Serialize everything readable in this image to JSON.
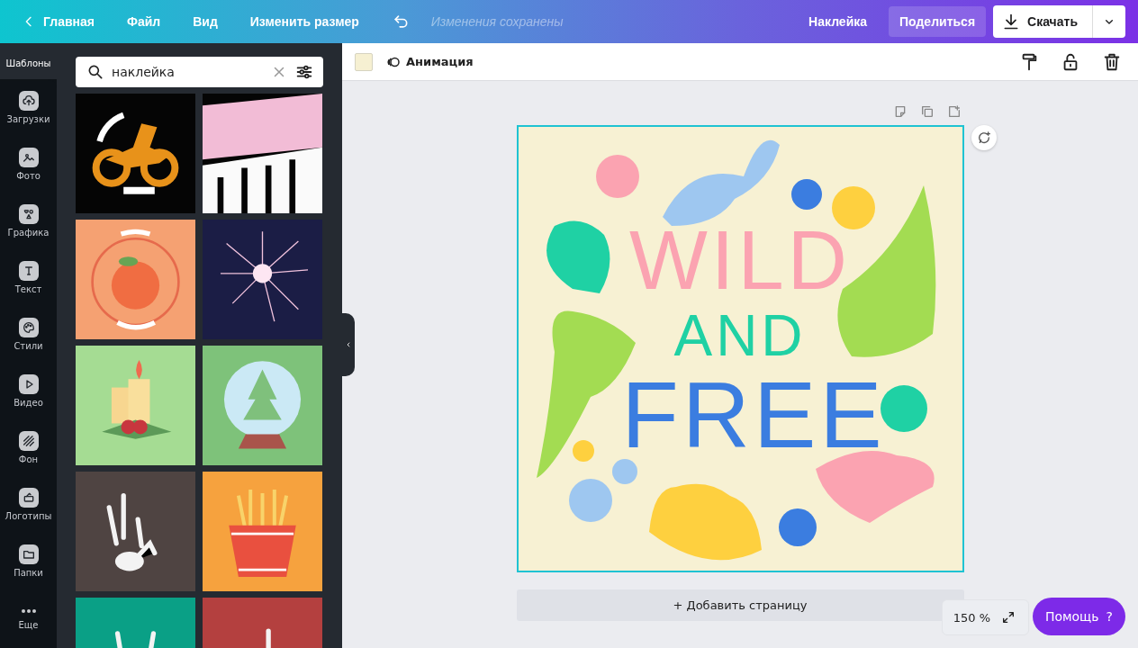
{
  "topbar": {
    "back": "Главная",
    "menu": [
      {
        "label": "Файл"
      },
      {
        "label": "Вид"
      },
      {
        "label": "Изменить размер"
      }
    ],
    "save_status": "Изменения сохранены",
    "design_name": "Наклейка",
    "share": "Поделиться",
    "download": "Скачать"
  },
  "sidebar": {
    "items": [
      {
        "label": "Шаблоны",
        "selected": true
      },
      {
        "label": "Загрузки",
        "selected": false
      },
      {
        "label": "Фото",
        "selected": false
      },
      {
        "label": "Графика",
        "selected": false
      },
      {
        "label": "Текст",
        "selected": false
      },
      {
        "label": "Стили",
        "selected": false
      },
      {
        "label": "Видео",
        "selected": false
      },
      {
        "label": "Фон",
        "selected": false
      },
      {
        "label": "Логотипы",
        "selected": false
      },
      {
        "label": "Папки",
        "selected": false
      },
      {
        "label": "Еще",
        "selected": false
      }
    ]
  },
  "panel": {
    "search": {
      "value": "наклейка"
    }
  },
  "toolbar": {
    "animation": "Анимация"
  },
  "design": {
    "words": [
      {
        "text": "WILD",
        "color": "#fba3b1"
      },
      {
        "text": "AND",
        "color": "#1fd1a4"
      },
      {
        "text": "FREE",
        "color": "#3b7de0"
      }
    ]
  },
  "add_page": "+ Добавить страницу",
  "zoom": "150 %",
  "help": {
    "label": "Помощь",
    "icon": "?"
  }
}
